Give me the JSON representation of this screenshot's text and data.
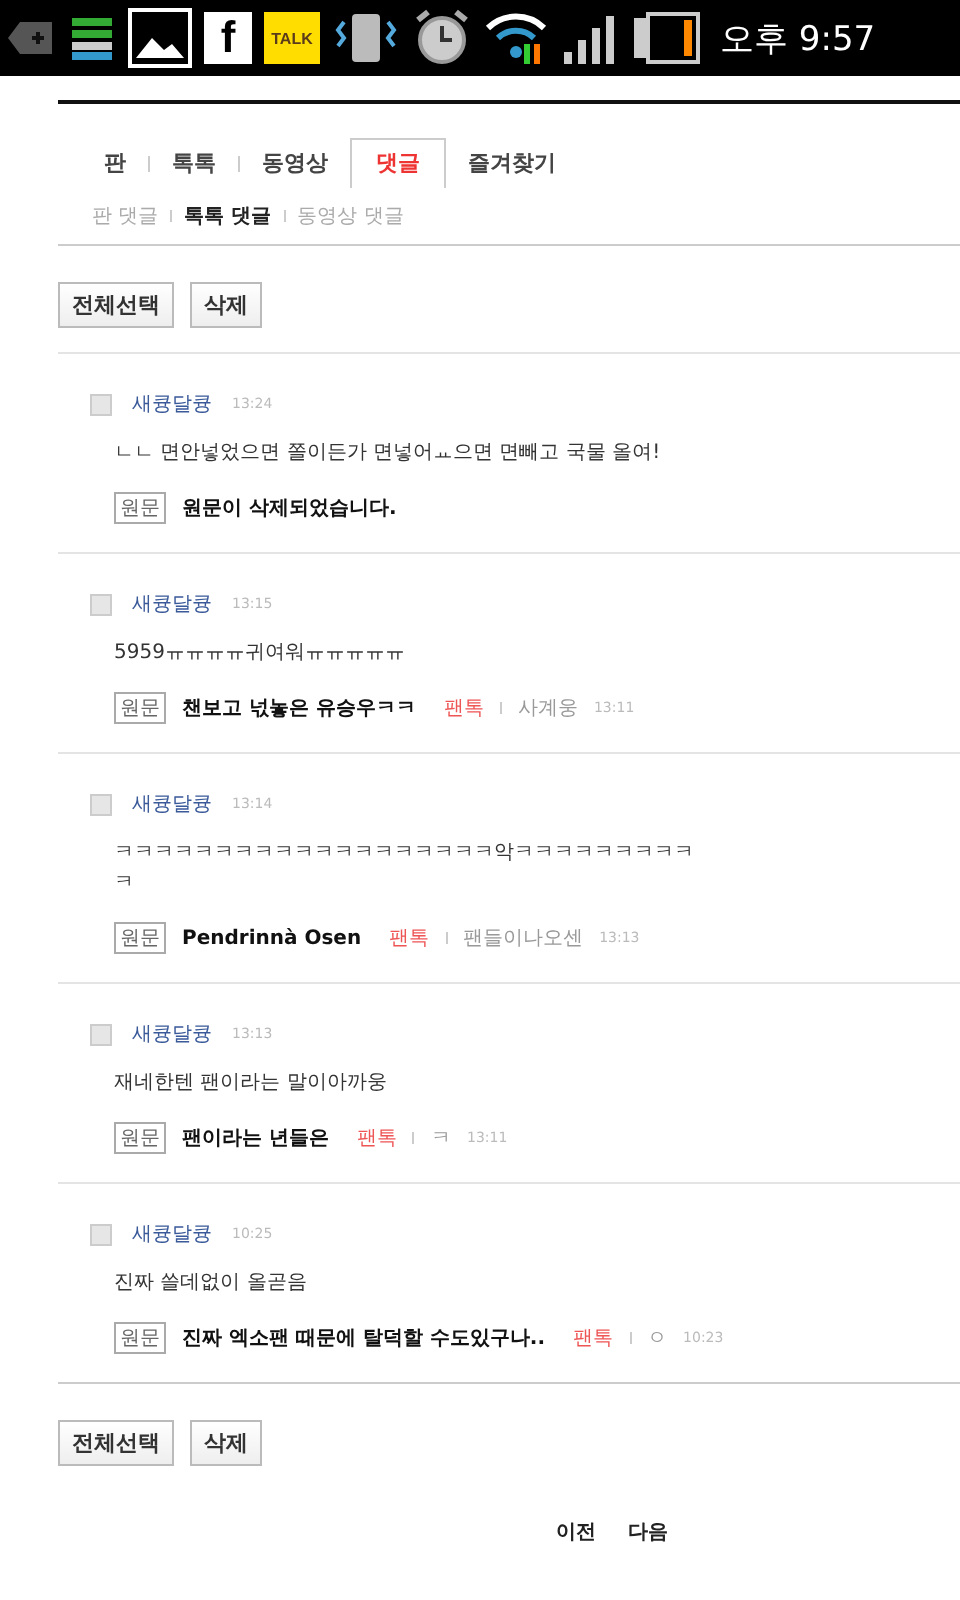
{
  "status_bar": {
    "facebook_label": "f",
    "talk_label": "TALK",
    "time": "오후 9:57"
  },
  "tabs": [
    {
      "label": "판",
      "selected": false
    },
    {
      "label": "톡톡",
      "selected": false
    },
    {
      "label": "동영상",
      "selected": false
    },
    {
      "label": "댓글",
      "selected": true
    },
    {
      "label": "즐겨찾기",
      "selected": false
    }
  ],
  "subtabs": [
    {
      "label": "판 댓글",
      "selected": false
    },
    {
      "label": "톡톡 댓글",
      "selected": true
    },
    {
      "label": "동영상 댓글",
      "selected": false
    }
  ],
  "actions_top": [
    "전체선택",
    "삭제"
  ],
  "comments": [
    {
      "checked": false,
      "nickname": "새큥달큥",
      "time": "13:24",
      "body": "ㄴㄴ 면안넣었으면 쫄이든가 면넣어ㅛ으면 면빼고 국물 올여!",
      "source_tag": "원문",
      "source_title": "원문이 삭제되었습니다."
    },
    {
      "checked": false,
      "nickname": "새큥달큥",
      "time": "13:15",
      "body": "5959ㅠㅠㅠㅠ귀여워ㅠㅠㅠㅠㅠ",
      "source_tag": "원문",
      "source_title": "챈보고 넋놓은 유승우ㅋㅋ",
      "source_board": "팬톡",
      "source_author": "사계웅",
      "source_time": "13:11"
    },
    {
      "checked": false,
      "nickname": "새큥달큥",
      "time": "13:14",
      "body": "ㅋㅋㅋㅋㅋㅋㅋㅋㅋㅋㅋㅋㅋㅋㅋㅋㅋㅋㅋ악ㅋㅋㅋㅋㅋㅋㅋㅋㅋㅋ",
      "source_tag": "원문",
      "source_title": "Pendrinnà Osen",
      "source_board": "팬톡",
      "source_author": "팬들이나오센",
      "source_time": "13:13"
    },
    {
      "checked": false,
      "nickname": "새큥달큥",
      "time": "13:13",
      "body": "재네한텐 팬이라는 말이아까웅",
      "source_tag": "원문",
      "source_title": "팬이라는 년들은",
      "source_board": "팬톡",
      "source_author": "ㅋ",
      "source_time": "13:11"
    },
    {
      "checked": false,
      "nickname": "새큥달큥",
      "time": "10:25",
      "body": "진짜 쓸데없이 올곧음",
      "source_tag": "원문",
      "source_title": "진짜 엑소팬 때문에 탈덕할 수도있구나..",
      "source_board": "팬톡",
      "source_author": "ㅇ",
      "source_time": "10:23"
    }
  ],
  "actions_bottom": [
    "전체선택",
    "삭제"
  ],
  "pager": [
    "이전",
    "다음"
  ]
}
